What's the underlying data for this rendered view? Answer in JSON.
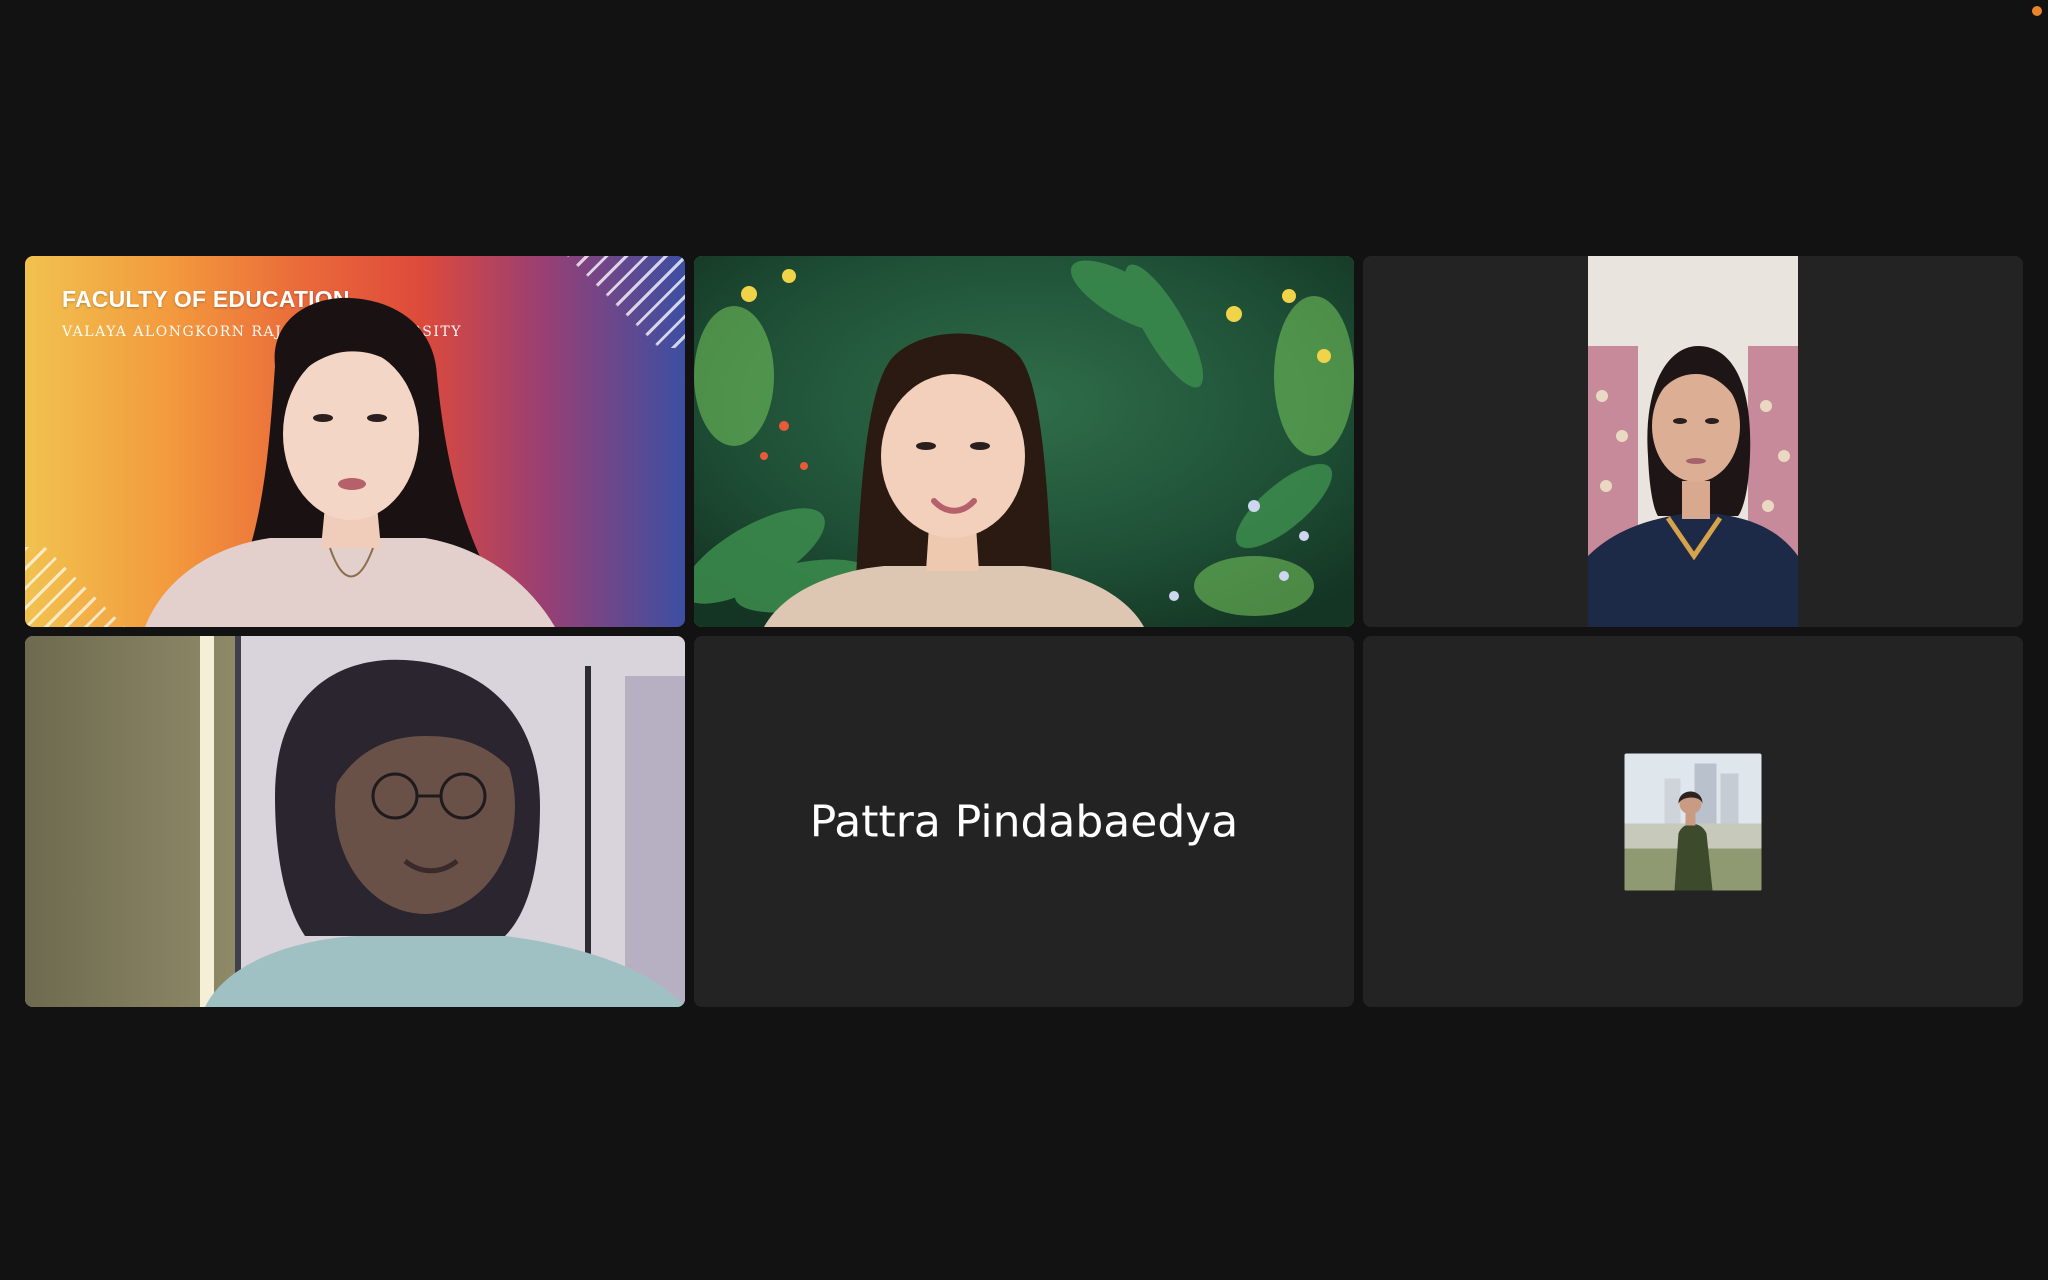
{
  "meeting": {
    "recording_indicator_color": "#e8842c",
    "active_speaker_color": "#5fd35f"
  },
  "tiles": [
    {
      "kind": "video",
      "background": "gradient",
      "virtual_background_title": "FACULTY OF EDUCATION",
      "virtual_background_subtitle": "VALAYA ALONGKORN RAJ",
      "virtual_background_subtitle_tail": "RSITY"
    },
    {
      "kind": "video",
      "background": "jungle-illustration",
      "active_speaker": true
    },
    {
      "kind": "video",
      "background": "portrait-camera"
    },
    {
      "kind": "video",
      "background": "window-room"
    },
    {
      "kind": "name-only",
      "participant_name": "Pattra Pindabaedya"
    },
    {
      "kind": "avatar",
      "avatar_image": "profile-photo"
    }
  ]
}
